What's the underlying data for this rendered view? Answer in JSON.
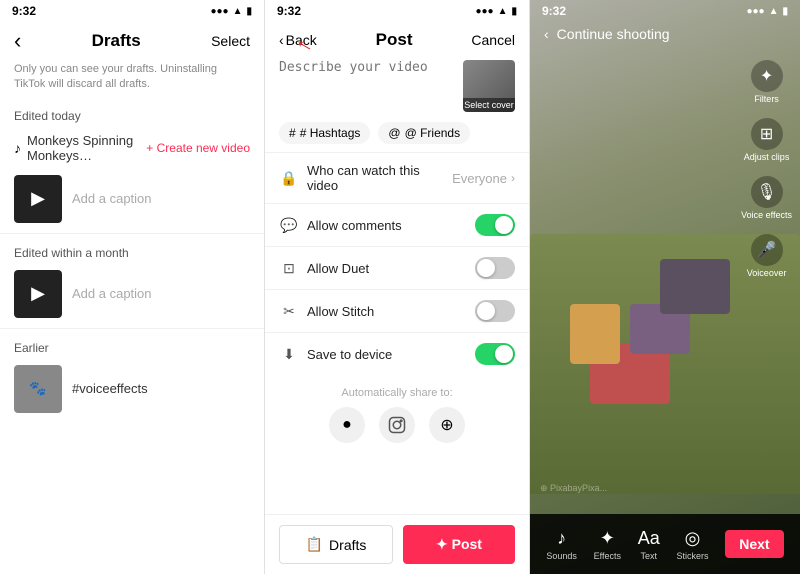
{
  "panel1": {
    "status_time": "9:32",
    "title": "Drafts",
    "select_label": "Select",
    "back_icon": "‹",
    "subtitle": "Only you can see your drafts. Uninstalling TikTok will discard all drafts.",
    "section_today": "Edited today",
    "song_title": "Monkeys Spinning Monkeys…",
    "create_new_label": "+ Create new video",
    "caption_placeholder": "Add a caption",
    "section_month": "Edited within a month",
    "section_earlier": "Earlier",
    "earlier_caption": "#voiceeffects"
  },
  "panel2": {
    "status_time": "9:32",
    "back_label": "Back",
    "post_label": "Post",
    "cancel_label": "Cancel",
    "describe_placeholder": "Describe your video",
    "select_cover_label": "Select cover",
    "hashtags_label": "# Hashtags",
    "friends_label": "@ Friends",
    "settings": [
      {
        "icon": "🔒",
        "label": "Who can watch this video",
        "value": "Everyone",
        "type": "chevron"
      },
      {
        "icon": "💬",
        "label": "Allow comments",
        "value": "",
        "type": "toggle-on"
      },
      {
        "icon": "⊙",
        "label": "Allow Duet",
        "value": "",
        "type": "toggle-off"
      },
      {
        "icon": "✂",
        "label": "Allow Stitch",
        "value": "",
        "type": "toggle-off"
      },
      {
        "icon": "⬇",
        "label": "Save to device",
        "value": "",
        "type": "toggle-on"
      }
    ],
    "share_label": "Automatically share to:",
    "drafts_btn": "Drafts",
    "post_btn": "✦ Post"
  },
  "panel3": {
    "status_time": "9:32",
    "continue_label": "Continue shooting",
    "tools": [
      {
        "icon": "✦",
        "label": "Filters"
      },
      {
        "icon": "⊞",
        "label": "Adjust clips"
      },
      {
        "icon": "🎙",
        "label": "Voice effects"
      },
      {
        "icon": "🎤",
        "label": "Voiceover"
      }
    ],
    "bottom_tools": [
      {
        "icon": "♪",
        "label": "Sounds"
      },
      {
        "icon": "✦",
        "label": "Effects"
      },
      {
        "icon": "Aa",
        "label": "Text"
      },
      {
        "icon": "◎",
        "label": "Stickers"
      }
    ],
    "next_label": "Next",
    "watermark": "⊕ PixabayPixa..."
  }
}
